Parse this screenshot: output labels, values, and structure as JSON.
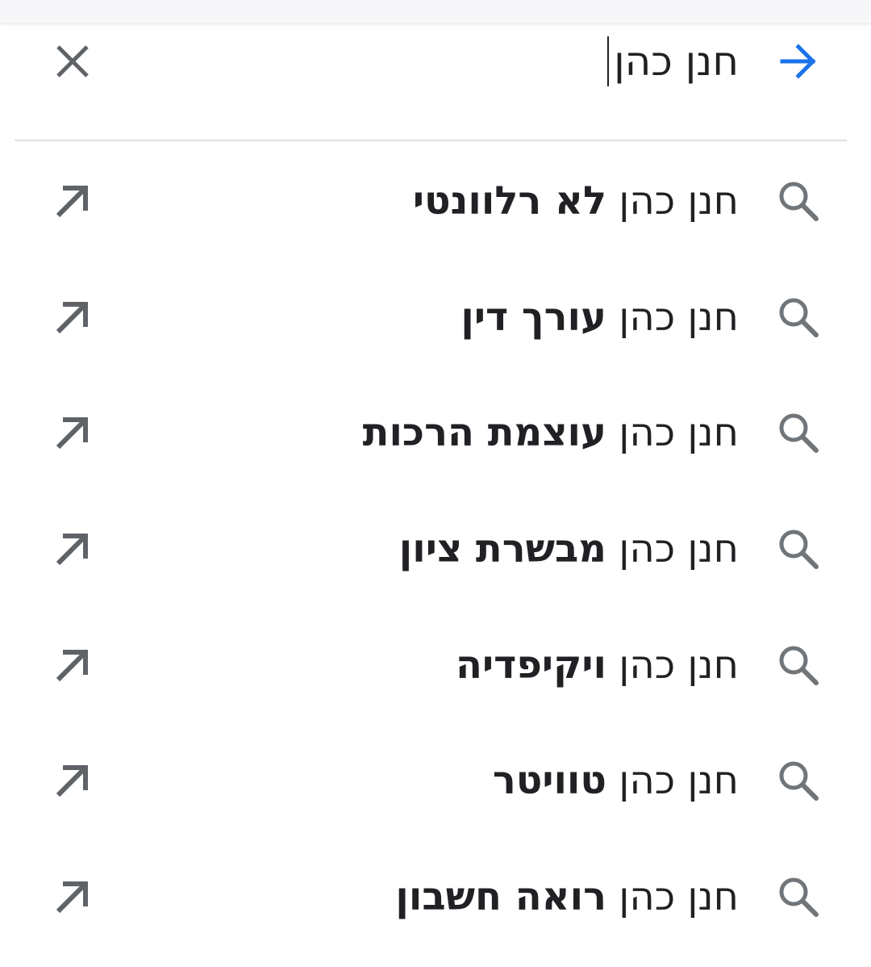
{
  "search": {
    "query": "חנן כהן",
    "go_icon": "arrow-right-icon",
    "clear_icon": "close-icon",
    "accent_color": "#1a73e8"
  },
  "suggestions": [
    {
      "prefix": "חנן כהן",
      "completion": "לא רלוונטי"
    },
    {
      "prefix": "חנן כהן",
      "completion": "עורך דין"
    },
    {
      "prefix": "חנן כהן",
      "completion": "עוצמת הרכות"
    },
    {
      "prefix": "חנן כהן",
      "completion": "מבשרת ציון"
    },
    {
      "prefix": "חנן כהן",
      "completion": "ויקיפדיה"
    },
    {
      "prefix": "חנן כהן",
      "completion": "טוויטר"
    },
    {
      "prefix": "חנן כהן",
      "completion": "רואה חשבון"
    }
  ]
}
